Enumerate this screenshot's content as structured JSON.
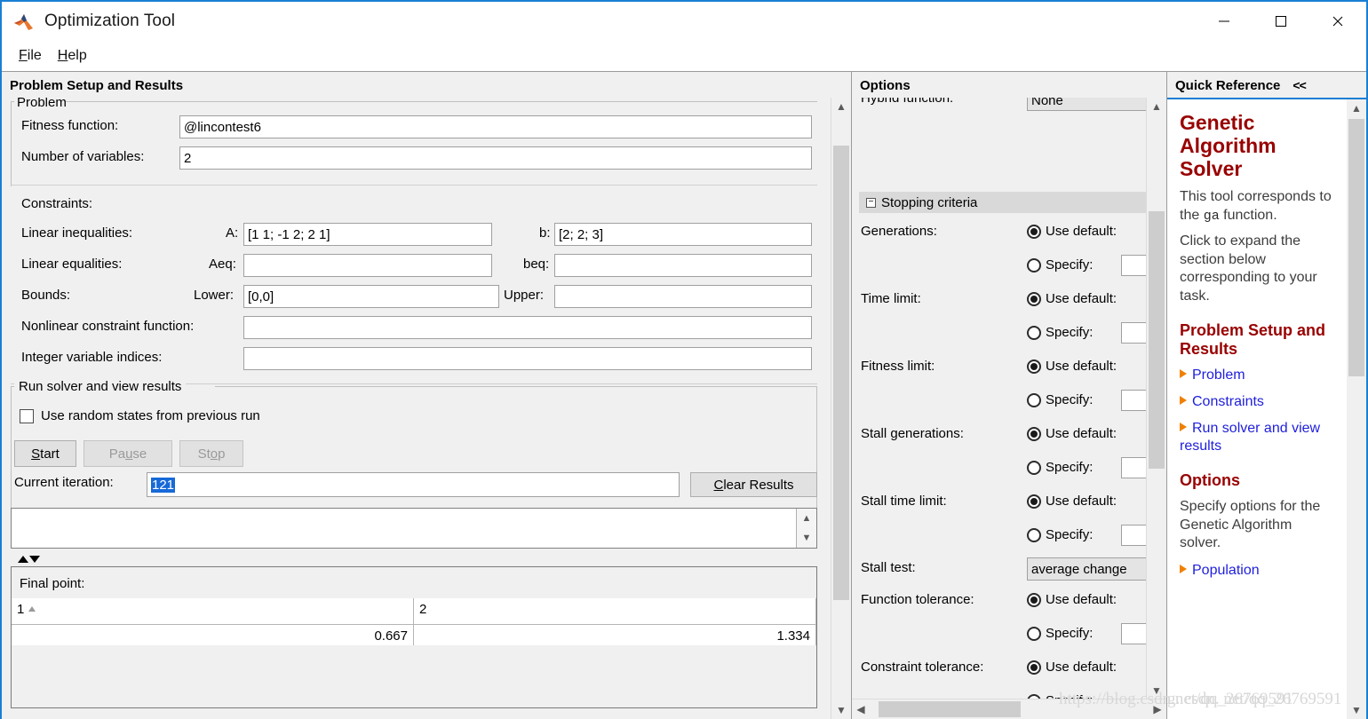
{
  "window": {
    "title": "Optimization Tool",
    "icon": "matlab-logo-icon",
    "minimize": "—",
    "maximize": "□",
    "close": "✕"
  },
  "menubar": {
    "items": [
      {
        "label": "File",
        "mnemonic": "F",
        "rest": "ile"
      },
      {
        "label": "Help",
        "mnemonic": "H",
        "rest": "elp"
      }
    ]
  },
  "panels": {
    "left_title": "Problem Setup and Results",
    "options_title": "Options",
    "quickref_title": "Quick Reference",
    "quickref_collapse": "<<"
  },
  "problem": {
    "group_label": "Problem",
    "fitness_label": "Fitness function:",
    "fitness_value": "@lincontest6",
    "numvars_label": "Number of variables:",
    "numvars_value": "2"
  },
  "constraints": {
    "heading": "Constraints:",
    "linear_inequalities_label": "Linear inequalities:",
    "a_label": "A:",
    "a_value": "[1 1; -1 2; 2 1]",
    "b_label": "b:",
    "b_value": "[2; 2; 3]",
    "linear_equalities_label": "Linear equalities:",
    "aeq_label": "Aeq:",
    "aeq_value": "",
    "beq_label": "beq:",
    "beq_value": "",
    "bounds_label": "Bounds:",
    "lower_label": "Lower:",
    "lower_value": "[0,0]",
    "upper_label": "Upper:",
    "upper_value": "",
    "nonlinear_label": "Nonlinear constraint function:",
    "nonlinear_value": "",
    "integer_label": "Integer variable indices:",
    "integer_value": ""
  },
  "run_solver": {
    "group_label": "Run solver and view results",
    "use_random_states_label": "Use random states from previous run",
    "use_random_states_checked": false,
    "start_label": "Start",
    "start_mnemonic": "S",
    "start_rest": "tart",
    "pause_label": "Pause",
    "pause_pre": "Pa",
    "pause_mnemonic": "u",
    "pause_rest": "se",
    "stop_label": "Stop",
    "stop_pre": "St",
    "stop_mnemonic": "o",
    "stop_rest": "p",
    "current_iteration_label": "Current iteration:",
    "current_iteration_value": "121",
    "clear_results_label": "Clear Results",
    "clear_mnemonic": "C",
    "clear_rest": "lear Results",
    "results_text": ""
  },
  "final_point": {
    "title": "Final point:",
    "columns": [
      "1",
      "2"
    ],
    "values": [
      "0.667",
      "1.334"
    ]
  },
  "options": {
    "hybrid_label": "Hybrid function:",
    "hybrid_value": "None",
    "stopping_section": "Stopping criteria",
    "expander_glyph": "−",
    "use_default_label": "Use default:",
    "specify_label": "Specify:",
    "rows": [
      {
        "label": "Generations:",
        "mode": "default",
        "specify_value": ""
      },
      {
        "label": "Time limit:",
        "mode": "default",
        "specify_value": ""
      },
      {
        "label": "Fitness limit:",
        "mode": "default",
        "specify_value": ""
      },
      {
        "label": "Stall generations:",
        "mode": "default",
        "specify_value": ""
      },
      {
        "label": "Stall time limit:",
        "mode": "default",
        "specify_value": ""
      }
    ],
    "stall_test_label": "Stall test:",
    "stall_test_value": "average change",
    "function_tolerance_label": "Function tolerance:",
    "constraint_tolerance_label": "Constraint tolerance:"
  },
  "quick_reference": {
    "heading": "Genetic Algorithm Solver",
    "para1_a": "This tool corresponds to the ",
    "para1_mono": "ga",
    "para1_b": " function.",
    "para2": "Click to expand the section below corresponding to your task.",
    "section1_heading": "Problem Setup and Results",
    "section1_links": [
      "Problem",
      "Constraints",
      "Run solver and view results"
    ],
    "section2_heading": "Options",
    "section2_para": "Specify options for the Genetic Algorithm solver.",
    "section2_links": [
      "Population"
    ]
  },
  "watermark": {
    "left": "https://blog.csdn.net/qq_26769591",
    "right": "g. csdn. net/qq_26769591"
  },
  "colors": {
    "accent": "#1a7fd4",
    "panel_bg": "#f0f0f0",
    "heading_red": "#990000",
    "link_blue": "#2020dd",
    "bullet_orange": "#ef8000",
    "selection_blue": "#1669d8"
  }
}
